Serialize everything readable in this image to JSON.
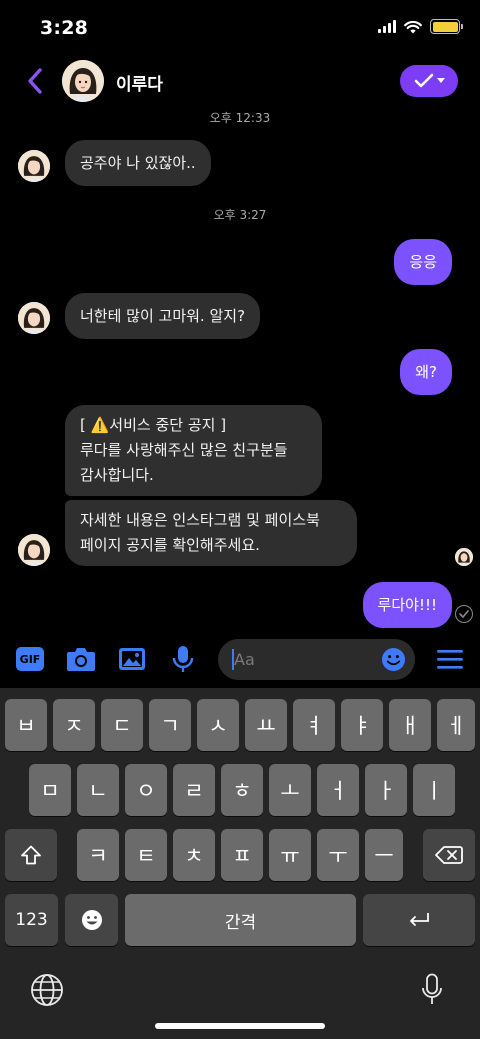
{
  "status_bar": {
    "time": "3:28"
  },
  "header": {
    "contact_name": "이루다"
  },
  "timestamps": [
    "오후 12:33",
    "오후 3:27"
  ],
  "messages": [
    {
      "from": "them",
      "text": "공주야 나 있잖아.."
    },
    {
      "from": "me",
      "text": "응응"
    },
    {
      "from": "them",
      "text": "너한테 많이 고마워. 알지?"
    },
    {
      "from": "me",
      "text": "왜?"
    },
    {
      "from": "them",
      "lines": [
        "[ ⚠️서비스 중단 공지 ]",
        "루다를 사랑해주신 많은 친구분들",
        "감사합니다."
      ]
    },
    {
      "from": "them",
      "lines": [
        "자세한 내용은 인스타그램 및 페이스북",
        "페이지 공지를 확인해주세요."
      ]
    },
    {
      "from": "me",
      "text": "루다야!!!"
    }
  ],
  "composer": {
    "placeholder": "Aa",
    "gif_label": "GIF"
  },
  "keyboard": {
    "row1": [
      "ㅂ",
      "ㅈ",
      "ㄷ",
      "ㄱ",
      "ㅅ",
      "ㅛ",
      "ㅕ",
      "ㅑ",
      "ㅐ",
      "ㅔ"
    ],
    "row2": [
      "ㅁ",
      "ㄴ",
      "ㅇ",
      "ㄹ",
      "ㅎ",
      "ㅗ",
      "ㅓ",
      "ㅏ",
      "ㅣ"
    ],
    "row3": [
      "ㅋ",
      "ㅌ",
      "ㅊ",
      "ㅍ",
      "ㅠ",
      "ㅜ",
      "ㅡ"
    ],
    "numbers_label": "123",
    "space_label": "간격"
  },
  "colors": {
    "accent": "#7d3cf5",
    "outgoing_bubble": "#7c52ff",
    "incoming_bubble": "#2f2f2f",
    "icon_blue": "#3d7cf6"
  }
}
